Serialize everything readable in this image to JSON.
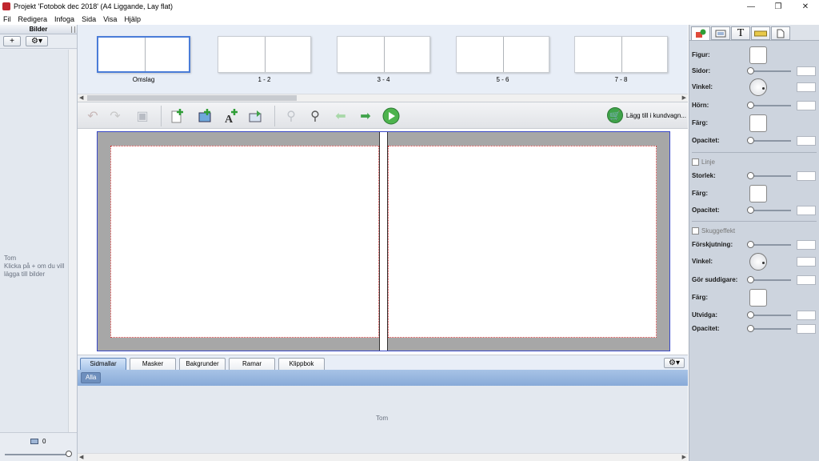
{
  "window": {
    "title": "Projekt 'Fotobok dec 2018' (A4 Liggande, Lay flat)",
    "minimize": "—",
    "restore": "❐",
    "close": "✕"
  },
  "menu": [
    "Fil",
    "Redigera",
    "Infoga",
    "Sida",
    "Visa",
    "Hjälp"
  ],
  "images_panel": {
    "header": "Bilder",
    "add_label": "+",
    "gear_label": "⚙▾",
    "empty_title": "Tom",
    "empty_hint": "Klicka på + om du vill lägga till bilder",
    "count": "0"
  },
  "spreads": [
    {
      "label": "Omslag",
      "selected": true
    },
    {
      "label": "1 - 2"
    },
    {
      "label": "3 - 4"
    },
    {
      "label": "5 - 6"
    },
    {
      "label": "7 - 8"
    }
  ],
  "toolbar": {
    "cart_label": "Lägg till i kundvagn..."
  },
  "bottom_tabs": [
    "Sidmallar",
    "Masker",
    "Bakgrunder",
    "Ramar",
    "Klippbok"
  ],
  "filter": "Alla",
  "gallery_empty": "Tom",
  "properties": {
    "figur": "Figur:",
    "sidor": "Sidor:",
    "vinkel": "Vinkel:",
    "horn": "Hörn:",
    "farg": "Färg:",
    "opacitet": "Opacitet:",
    "linje": "Linje",
    "storlek": "Storlek:",
    "farg2": "Färg:",
    "opacitet2": "Opacitet:",
    "skuggeffekt": "Skuggeffekt",
    "forskjutning": "Förskjutning:",
    "vinkel2": "Vinkel:",
    "suddigare": "Gör suddigare:",
    "farg3": "Färg:",
    "utvidga": "Utvidga:",
    "opacitet3": "Opacitet:"
  }
}
